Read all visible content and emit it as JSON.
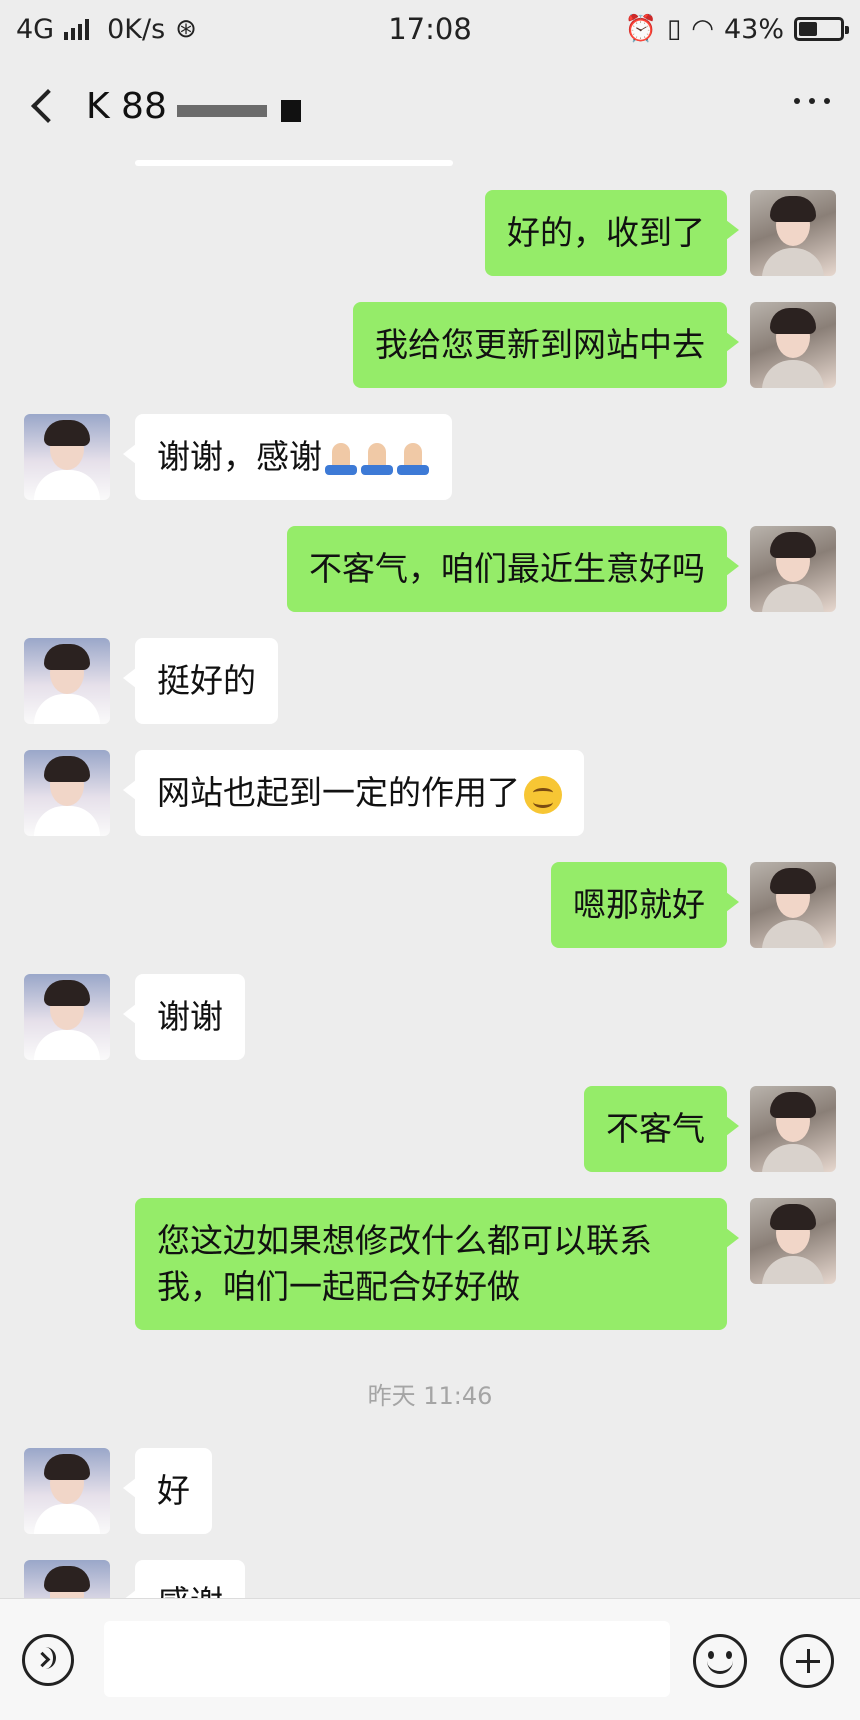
{
  "status": {
    "network": "4G",
    "speed": "0K/s",
    "time": "17:08",
    "battery": "43%",
    "battery_fraction": 0.43
  },
  "nav": {
    "title": "K 88"
  },
  "messages": [
    {
      "from": "me",
      "text": "好的，收到了"
    },
    {
      "from": "me",
      "text": "我给您更新到网站中去"
    },
    {
      "from": "other",
      "text": "谢谢，感谢",
      "emoji": "pray-pray-pray"
    },
    {
      "from": "me",
      "text": "不客气，咱们最近生意好吗"
    },
    {
      "from": "other",
      "text": "挺好的"
    },
    {
      "from": "other",
      "text": "网站也起到一定的作用了",
      "emoji": "smile"
    },
    {
      "from": "me",
      "text": "嗯那就好"
    },
    {
      "from": "other",
      "text": "谢谢"
    },
    {
      "from": "me",
      "text": "不客气"
    },
    {
      "from": "me",
      "text": "您这边如果想修改什么都可以联系我，咱们一起配合好好做"
    },
    {
      "timestamp": "昨天 11:46"
    },
    {
      "from": "other",
      "text": "好"
    },
    {
      "from": "other",
      "text": "感谢"
    }
  ],
  "colors": {
    "my_bubble": "#95ec69",
    "other_bubble": "#ffffff",
    "background": "#ededed"
  }
}
